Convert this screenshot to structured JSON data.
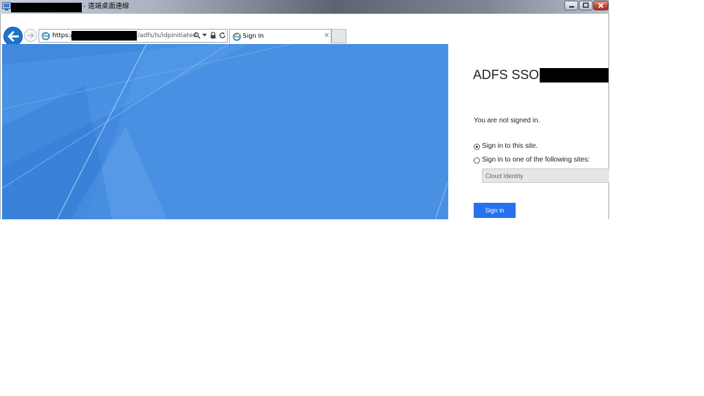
{
  "window": {
    "title_suffix": "- 遠端桌面連線",
    "icon": "remote-desktop-icon"
  },
  "browser": {
    "address_scheme": "https://",
    "address_path": "/adfs/ls/idpinitiated",
    "tab_title": "Sign In",
    "tab_close": "×",
    "icons": [
      "back-icon",
      "forward-icon",
      "ie-icon",
      "search-icon",
      "lock-icon",
      "refresh-icon",
      "close-icon"
    ]
  },
  "page": {
    "title": "ADFS SSO",
    "status": "You are not signed in.",
    "options": [
      {
        "label": "Sign in to this site.",
        "selected": true
      },
      {
        "label": "Sign in to one of the following sites:",
        "selected": false
      }
    ],
    "site_select_value": "Cloud Identity",
    "signin_label": "Sign in",
    "colors": {
      "accent": "#2672ec",
      "illustration": "#4a90e2"
    }
  }
}
